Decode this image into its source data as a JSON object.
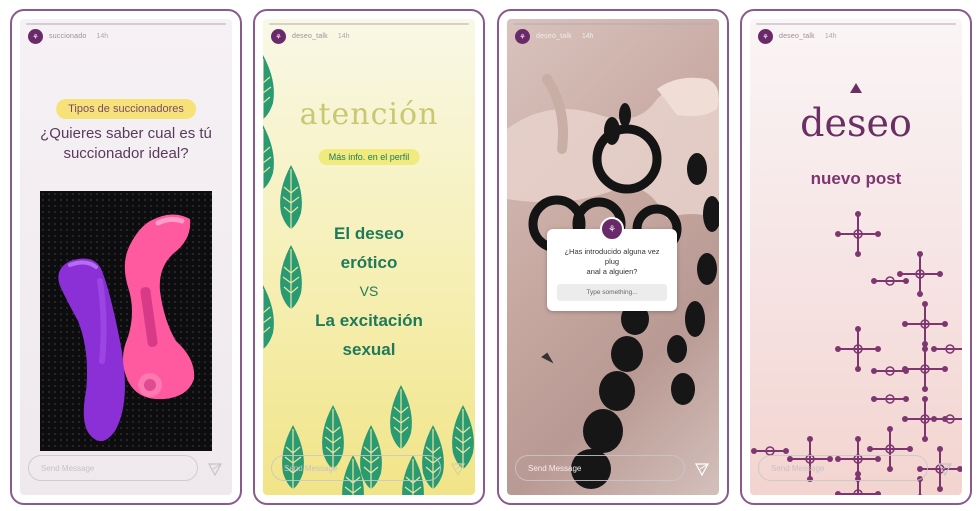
{
  "stories": [
    {
      "username": "succionado",
      "time": "14h",
      "tag": "Tipos de succionadores",
      "question_line1": "¿Quieres saber cual es tú",
      "question_line2": "succionador ideal?",
      "message_placeholder": "Send Message"
    },
    {
      "username": "deseo_talk",
      "time": "14h",
      "title": "atención",
      "tag": "Más info. en el perfil",
      "line1": "El deseo",
      "line2": "erótico",
      "vs": "VS",
      "line3": "La excitación",
      "line4": "sexual",
      "message_placeholder": "Send Message"
    },
    {
      "username": "deseo_talk",
      "time": "14h",
      "question_line1": "¿Has introducido alguna vez plug",
      "question_line2": "anal a alguien?",
      "answer_placeholder": "Type something...",
      "message_placeholder": "Send Message"
    },
    {
      "username": "deseo_talk",
      "time": "14h",
      "title": "deseo",
      "subtitle": "nuevo post",
      "message_placeholder": "Send Message"
    }
  ],
  "colors": {
    "frame": "#8a5a8e",
    "brand_purple": "#6a2f63",
    "green_text": "#1e7a5a",
    "pill_yellow": "#f7e27a",
    "pill_green": "#f1eb7e"
  }
}
